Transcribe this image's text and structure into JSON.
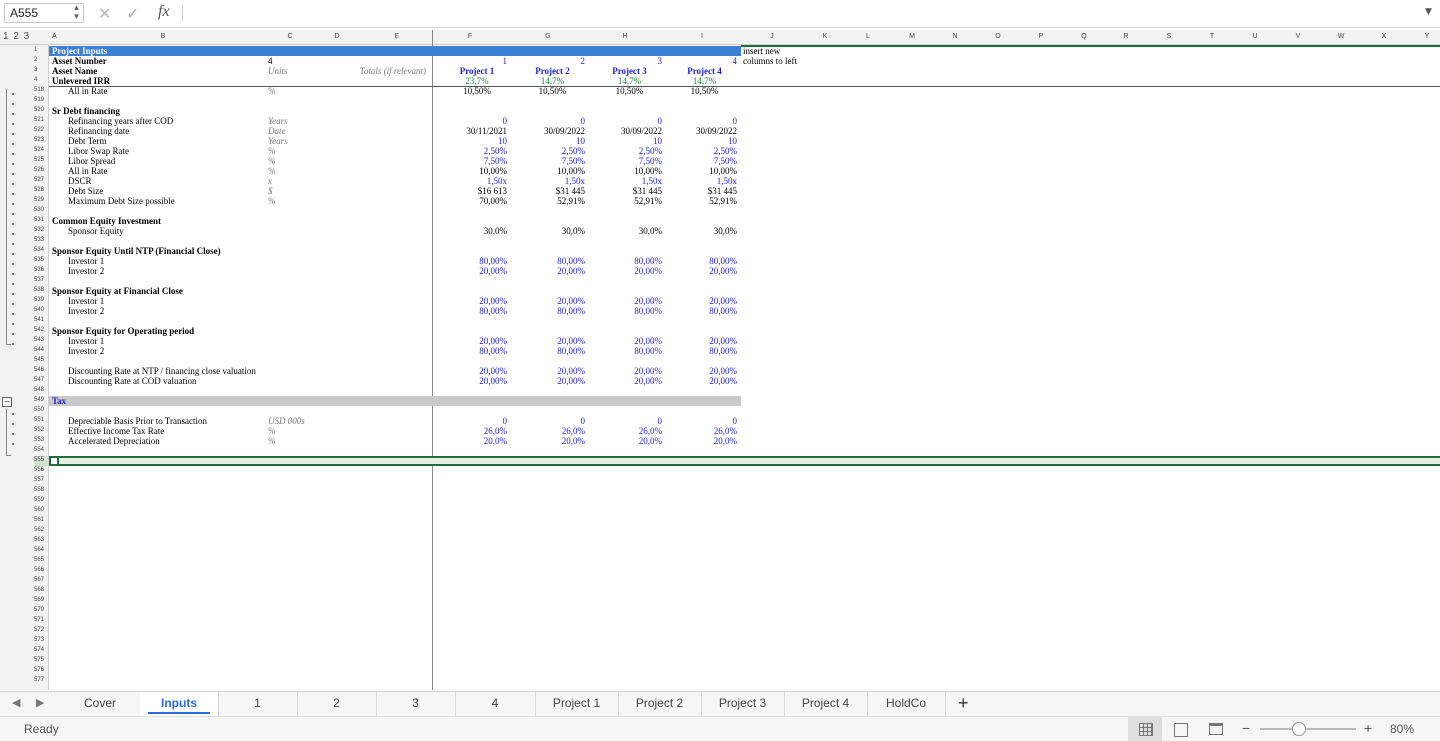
{
  "formula_bar": {
    "name_box": "A555",
    "fx_label": "fx",
    "formula": ""
  },
  "outline_levels": "1 2 3",
  "columns": [
    "A",
    "B",
    "C",
    "D",
    "E",
    "F",
    "G",
    "H",
    "I",
    "J",
    "K",
    "L",
    "M",
    "N",
    "O",
    "P",
    "Q",
    "R",
    "S",
    "T",
    "U",
    "V",
    "W",
    "X",
    "Y"
  ],
  "rows": [
    {
      "n": "1",
      "a": "Project Inputs",
      "band": "blue",
      "bold": true
    },
    {
      "n": "2",
      "a": "Asset Number",
      "bold": true,
      "c": "4",
      "f": "1",
      "g": "2",
      "h": "3",
      "i": "4",
      "num_color": "blue"
    },
    {
      "n": "3",
      "a": "Asset Name",
      "bold": true,
      "c": "Units",
      "e": "Totals (if relevant)",
      "f": "Project 1",
      "g": "Project 2",
      "h": "Project 3",
      "i": "Project 4",
      "num_color": "blue",
      "num_bold": true
    },
    {
      "n": "4",
      "a": "Unlevered IRR",
      "bold": true,
      "f": "23,7%",
      "g": "14,7%",
      "h": "14,7%",
      "i": "14,7%",
      "num_color": "green"
    },
    {
      "n": "518",
      "b": "All in Rate",
      "c": "%",
      "f": "10,50%",
      "g": "10,50%",
      "h": "10,50%",
      "i": "10,50%"
    },
    {
      "n": "519"
    },
    {
      "n": "520",
      "a": "Sr Debt financing",
      "bold": true
    },
    {
      "n": "521",
      "b": "Refinancing years after COD",
      "c": "Years",
      "f": "0",
      "g": "0",
      "h": "0",
      "i": "0",
      "num_color": "blue"
    },
    {
      "n": "522",
      "b": "Refinancing date",
      "c": "Date",
      "f": "30/11/2021",
      "g": "30/09/2022",
      "h": "30/09/2022",
      "i": "30/09/2022"
    },
    {
      "n": "523",
      "b": "Debt Term",
      "c": "Years",
      "f": "10",
      "g": "10",
      "h": "10",
      "i": "10",
      "num_color": "blue"
    },
    {
      "n": "524",
      "b": "Libor Swap Rate",
      "c": "%",
      "f": "2,50%",
      "g": "2,50%",
      "h": "2,50%",
      "i": "2,50%",
      "num_color": "blue"
    },
    {
      "n": "525",
      "b": "Libor Spread",
      "c": "%",
      "f": "7,50%",
      "g": "7,50%",
      "h": "7,50%",
      "i": "7,50%",
      "num_color": "blue"
    },
    {
      "n": "526",
      "b": "All in Rate",
      "c": "%",
      "f": "10,00%",
      "g": "10,00%",
      "h": "10,00%",
      "i": "10,00%"
    },
    {
      "n": "527",
      "b": "DSCR",
      "c": "x",
      "f": "1,50x",
      "g": "1,50x",
      "h": "1,50x",
      "i": "1,50x",
      "num_color": "blue"
    },
    {
      "n": "528",
      "b": "Debt Size",
      "c": "$",
      "f": "$16 613",
      "g": "$31 445",
      "h": "$31 445",
      "i": "$31 445"
    },
    {
      "n": "529",
      "b": "Maximum Debt Size possible",
      "c": "%",
      "f": "70,00%",
      "g": "52,91%",
      "h": "52,91%",
      "i": "52,91%"
    },
    {
      "n": "530"
    },
    {
      "n": "531",
      "a": "Common Equity Investment",
      "bold": true
    },
    {
      "n": "532",
      "b": "Sponsor Equity",
      "f": "30,0%",
      "g": "30,0%",
      "h": "30,0%",
      "i": "30,0%"
    },
    {
      "n": "533"
    },
    {
      "n": "534",
      "a": "Sponsor Equity Until NTP (Financial Close)",
      "bold": true
    },
    {
      "n": "535",
      "b": "Investor 1",
      "f": "80,00%",
      "g": "80,00%",
      "h": "80,00%",
      "i": "80,00%",
      "num_color": "blue"
    },
    {
      "n": "536",
      "b": "Investor 2",
      "f": "20,00%",
      "g": "20,00%",
      "h": "20,00%",
      "i": "20,00%",
      "num_color": "blue"
    },
    {
      "n": "537"
    },
    {
      "n": "538",
      "a": "Sponsor Equity at Financial Close",
      "bold": true
    },
    {
      "n": "539",
      "b": "Investor 1",
      "f": "20,00%",
      "g": "20,00%",
      "h": "20,00%",
      "i": "20,00%",
      "num_color": "blue"
    },
    {
      "n": "540",
      "b": "Investor 2",
      "f": "80,00%",
      "g": "80,00%",
      "h": "80,00%",
      "i": "80,00%",
      "num_color": "blue"
    },
    {
      "n": "541"
    },
    {
      "n": "542",
      "a": "Sponsor Equity for Operating period",
      "bold": true
    },
    {
      "n": "543",
      "b": "Investor 1",
      "f": "20,00%",
      "g": "20,00%",
      "h": "20,00%",
      "i": "20,00%",
      "num_color": "blue"
    },
    {
      "n": "544",
      "b": "Investor 2",
      "f": "80,00%",
      "g": "80,00%",
      "h": "80,00%",
      "i": "80,00%",
      "num_color": "blue"
    },
    {
      "n": "545"
    },
    {
      "n": "546",
      "b": "Discounting Rate at NTP / financing close valuation",
      "f": "20,00%",
      "g": "20,00%",
      "h": "20,00%",
      "i": "20,00%",
      "num_color": "blue"
    },
    {
      "n": "547",
      "b": "Discounting Rate at COD valuation",
      "f": "20,00%",
      "g": "20,00%",
      "h": "20,00%",
      "i": "20,00%",
      "num_color": "blue"
    },
    {
      "n": "548"
    },
    {
      "n": "549",
      "a": "Tax",
      "band": "grey",
      "bold": true
    },
    {
      "n": "550"
    },
    {
      "n": "551",
      "b": "Depreciable Basis Prior to Transaction",
      "c": "USD 000s",
      "f": "0",
      "g": "0",
      "h": "0",
      "i": "0",
      "num_color": "blue"
    },
    {
      "n": "552",
      "b": "Effective Income Tax Rate",
      "c": "%",
      "f": "26,0%",
      "g": "26,0%",
      "h": "26,0%",
      "i": "26,0%",
      "num_color": "blue"
    },
    {
      "n": "553",
      "b": "Accelerated Depreciation",
      "c": "%",
      "f": "20,0%",
      "g": "20,0%",
      "h": "20,0%",
      "i": "20,0%",
      "num_color": "blue"
    },
    {
      "n": "554"
    },
    {
      "n": "555",
      "selected": true
    },
    {
      "n": "556"
    },
    {
      "n": "557"
    },
    {
      "n": "558"
    },
    {
      "n": "559"
    },
    {
      "n": "560"
    },
    {
      "n": "561"
    },
    {
      "n": "562"
    },
    {
      "n": "563"
    },
    {
      "n": "564"
    },
    {
      "n": "565"
    },
    {
      "n": "566"
    },
    {
      "n": "567"
    },
    {
      "n": "568"
    },
    {
      "n": "569"
    },
    {
      "n": "570"
    },
    {
      "n": "571"
    },
    {
      "n": "572"
    },
    {
      "n": "573"
    },
    {
      "n": "574"
    },
    {
      "n": "575"
    },
    {
      "n": "576"
    },
    {
      "n": "577"
    }
  ],
  "note_j1": "insert new",
  "note_j2": "columns to left",
  "tabs": [
    "Cover",
    "Inputs",
    "1",
    "2",
    "3",
    "4",
    "Project 1",
    "Project 2",
    "Project 3",
    "Project 4",
    "HoldCo"
  ],
  "active_tab": "Inputs",
  "add_sheet": "+",
  "status": {
    "text": "Ready",
    "zoom": "80%",
    "minus": "−",
    "plus": "+"
  },
  "colors": {
    "blue_band": "#3d7fd3",
    "input_blue": "#1f1fd1",
    "irr_green": "#1a8a3a",
    "active_tab": "#2b6bd6"
  }
}
